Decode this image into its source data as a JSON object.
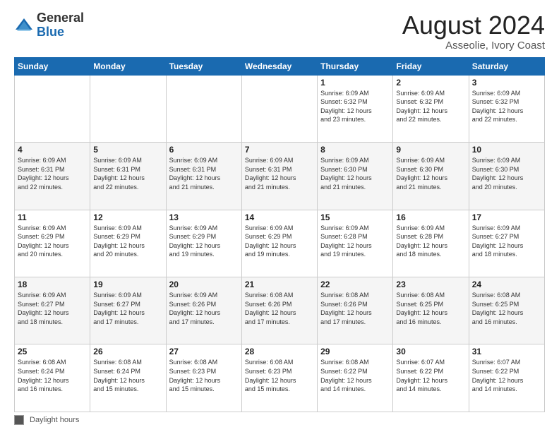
{
  "header": {
    "logo_general": "General",
    "logo_blue": "Blue",
    "month_year": "August 2024",
    "location": "Asseolie, Ivory Coast"
  },
  "footer": {
    "daylight_label": "Daylight hours"
  },
  "days_of_week": [
    "Sunday",
    "Monday",
    "Tuesday",
    "Wednesday",
    "Thursday",
    "Friday",
    "Saturday"
  ],
  "weeks": [
    [
      {
        "day": "",
        "info": ""
      },
      {
        "day": "",
        "info": ""
      },
      {
        "day": "",
        "info": ""
      },
      {
        "day": "",
        "info": ""
      },
      {
        "day": "1",
        "info": "Sunrise: 6:09 AM\nSunset: 6:32 PM\nDaylight: 12 hours\nand 23 minutes."
      },
      {
        "day": "2",
        "info": "Sunrise: 6:09 AM\nSunset: 6:32 PM\nDaylight: 12 hours\nand 22 minutes."
      },
      {
        "day": "3",
        "info": "Sunrise: 6:09 AM\nSunset: 6:32 PM\nDaylight: 12 hours\nand 22 minutes."
      }
    ],
    [
      {
        "day": "4",
        "info": "Sunrise: 6:09 AM\nSunset: 6:31 PM\nDaylight: 12 hours\nand 22 minutes."
      },
      {
        "day": "5",
        "info": "Sunrise: 6:09 AM\nSunset: 6:31 PM\nDaylight: 12 hours\nand 22 minutes."
      },
      {
        "day": "6",
        "info": "Sunrise: 6:09 AM\nSunset: 6:31 PM\nDaylight: 12 hours\nand 21 minutes."
      },
      {
        "day": "7",
        "info": "Sunrise: 6:09 AM\nSunset: 6:31 PM\nDaylight: 12 hours\nand 21 minutes."
      },
      {
        "day": "8",
        "info": "Sunrise: 6:09 AM\nSunset: 6:30 PM\nDaylight: 12 hours\nand 21 minutes."
      },
      {
        "day": "9",
        "info": "Sunrise: 6:09 AM\nSunset: 6:30 PM\nDaylight: 12 hours\nand 21 minutes."
      },
      {
        "day": "10",
        "info": "Sunrise: 6:09 AM\nSunset: 6:30 PM\nDaylight: 12 hours\nand 20 minutes."
      }
    ],
    [
      {
        "day": "11",
        "info": "Sunrise: 6:09 AM\nSunset: 6:29 PM\nDaylight: 12 hours\nand 20 minutes."
      },
      {
        "day": "12",
        "info": "Sunrise: 6:09 AM\nSunset: 6:29 PM\nDaylight: 12 hours\nand 20 minutes."
      },
      {
        "day": "13",
        "info": "Sunrise: 6:09 AM\nSunset: 6:29 PM\nDaylight: 12 hours\nand 19 minutes."
      },
      {
        "day": "14",
        "info": "Sunrise: 6:09 AM\nSunset: 6:29 PM\nDaylight: 12 hours\nand 19 minutes."
      },
      {
        "day": "15",
        "info": "Sunrise: 6:09 AM\nSunset: 6:28 PM\nDaylight: 12 hours\nand 19 minutes."
      },
      {
        "day": "16",
        "info": "Sunrise: 6:09 AM\nSunset: 6:28 PM\nDaylight: 12 hours\nand 18 minutes."
      },
      {
        "day": "17",
        "info": "Sunrise: 6:09 AM\nSunset: 6:27 PM\nDaylight: 12 hours\nand 18 minutes."
      }
    ],
    [
      {
        "day": "18",
        "info": "Sunrise: 6:09 AM\nSunset: 6:27 PM\nDaylight: 12 hours\nand 18 minutes."
      },
      {
        "day": "19",
        "info": "Sunrise: 6:09 AM\nSunset: 6:27 PM\nDaylight: 12 hours\nand 17 minutes."
      },
      {
        "day": "20",
        "info": "Sunrise: 6:09 AM\nSunset: 6:26 PM\nDaylight: 12 hours\nand 17 minutes."
      },
      {
        "day": "21",
        "info": "Sunrise: 6:08 AM\nSunset: 6:26 PM\nDaylight: 12 hours\nand 17 minutes."
      },
      {
        "day": "22",
        "info": "Sunrise: 6:08 AM\nSunset: 6:26 PM\nDaylight: 12 hours\nand 17 minutes."
      },
      {
        "day": "23",
        "info": "Sunrise: 6:08 AM\nSunset: 6:25 PM\nDaylight: 12 hours\nand 16 minutes."
      },
      {
        "day": "24",
        "info": "Sunrise: 6:08 AM\nSunset: 6:25 PM\nDaylight: 12 hours\nand 16 minutes."
      }
    ],
    [
      {
        "day": "25",
        "info": "Sunrise: 6:08 AM\nSunset: 6:24 PM\nDaylight: 12 hours\nand 16 minutes."
      },
      {
        "day": "26",
        "info": "Sunrise: 6:08 AM\nSunset: 6:24 PM\nDaylight: 12 hours\nand 15 minutes."
      },
      {
        "day": "27",
        "info": "Sunrise: 6:08 AM\nSunset: 6:23 PM\nDaylight: 12 hours\nand 15 minutes."
      },
      {
        "day": "28",
        "info": "Sunrise: 6:08 AM\nSunset: 6:23 PM\nDaylight: 12 hours\nand 15 minutes."
      },
      {
        "day": "29",
        "info": "Sunrise: 6:08 AM\nSunset: 6:22 PM\nDaylight: 12 hours\nand 14 minutes."
      },
      {
        "day": "30",
        "info": "Sunrise: 6:07 AM\nSunset: 6:22 PM\nDaylight: 12 hours\nand 14 minutes."
      },
      {
        "day": "31",
        "info": "Sunrise: 6:07 AM\nSunset: 6:22 PM\nDaylight: 12 hours\nand 14 minutes."
      }
    ]
  ]
}
